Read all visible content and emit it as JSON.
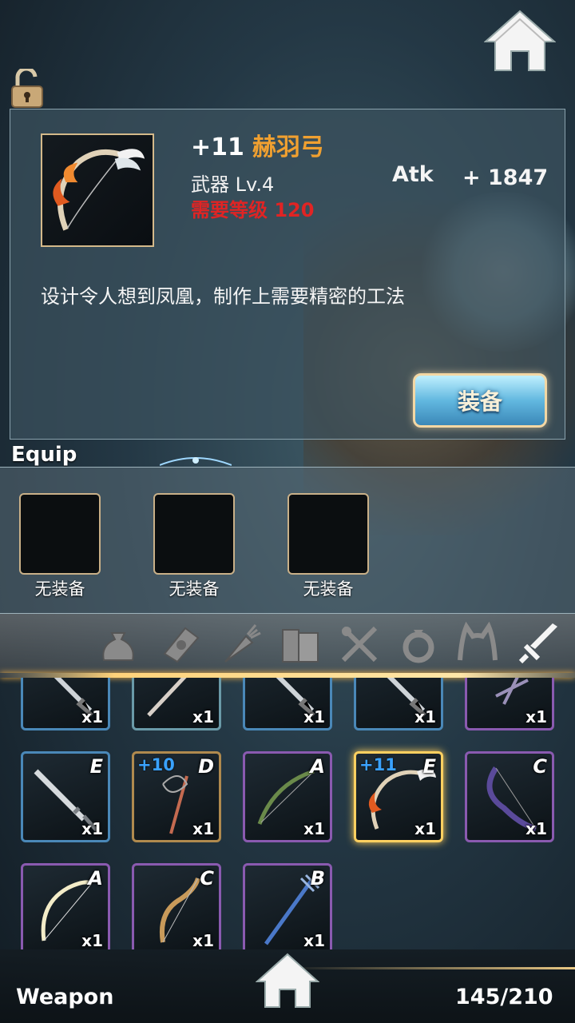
{
  "item": {
    "plus": "+11",
    "name": "赫羽弓",
    "type_level": "武器 Lv.4",
    "requirement": "需要等级 120",
    "stat_label": "Atk",
    "stat_value": "+ 1847",
    "description": "设计令人想到凤凰，制作上需要精密的工法",
    "equip_button": "装备"
  },
  "equip": {
    "title": "Equip",
    "slots": [
      {
        "label": "无装备"
      },
      {
        "label": "无装备"
      },
      {
        "label": "无装备"
      }
    ]
  },
  "tabs": [
    {
      "icon": "bag-icon"
    },
    {
      "icon": "scroll-icon"
    },
    {
      "icon": "carrot-icon"
    },
    {
      "icon": "books-icon"
    },
    {
      "icon": "fork-spoon-icon"
    },
    {
      "icon": "ring-icon"
    },
    {
      "icon": "cat-ear-headband-icon"
    },
    {
      "icon": "sword-icon",
      "active": true
    }
  ],
  "inventory": {
    "rows": [
      [
        {
          "icon": "sword-icon",
          "qty": "x1"
        },
        {
          "icon": "spear-icon",
          "qty": "x1"
        },
        {
          "icon": "sword-icon",
          "qty": "x1"
        },
        {
          "icon": "sword-icon",
          "qty": "x1"
        },
        {
          "icon": "crossbow-icon",
          "qty": "x1"
        }
      ],
      [
        {
          "icon": "sword-icon",
          "grade": "E",
          "qty": "x1"
        },
        {
          "icon": "whip-staff-icon",
          "plus": "+10",
          "grade": "D",
          "qty": "x1"
        },
        {
          "icon": "vine-bow-icon",
          "grade": "A",
          "qty": "x1"
        },
        {
          "icon": "phoenix-bow-icon",
          "plus": "+11",
          "grade": "E",
          "qty": "x1"
        },
        {
          "icon": "dark-bow-icon",
          "grade": "C",
          "qty": "x1"
        }
      ],
      [
        {
          "icon": "light-bow-icon",
          "grade": "A",
          "qty": "x1"
        },
        {
          "icon": "gold-bow-icon",
          "grade": "C",
          "qty": "x1"
        },
        {
          "icon": "trident-staff-icon",
          "grade": "B",
          "qty": "x1"
        }
      ]
    ]
  },
  "footer": {
    "title": "Weapon",
    "count": "145/210"
  },
  "colors": {
    "item_name": "#f0a030",
    "requirement": "#e02424",
    "enhance": "#3aa2ff",
    "selected_border": "#ffd060"
  }
}
